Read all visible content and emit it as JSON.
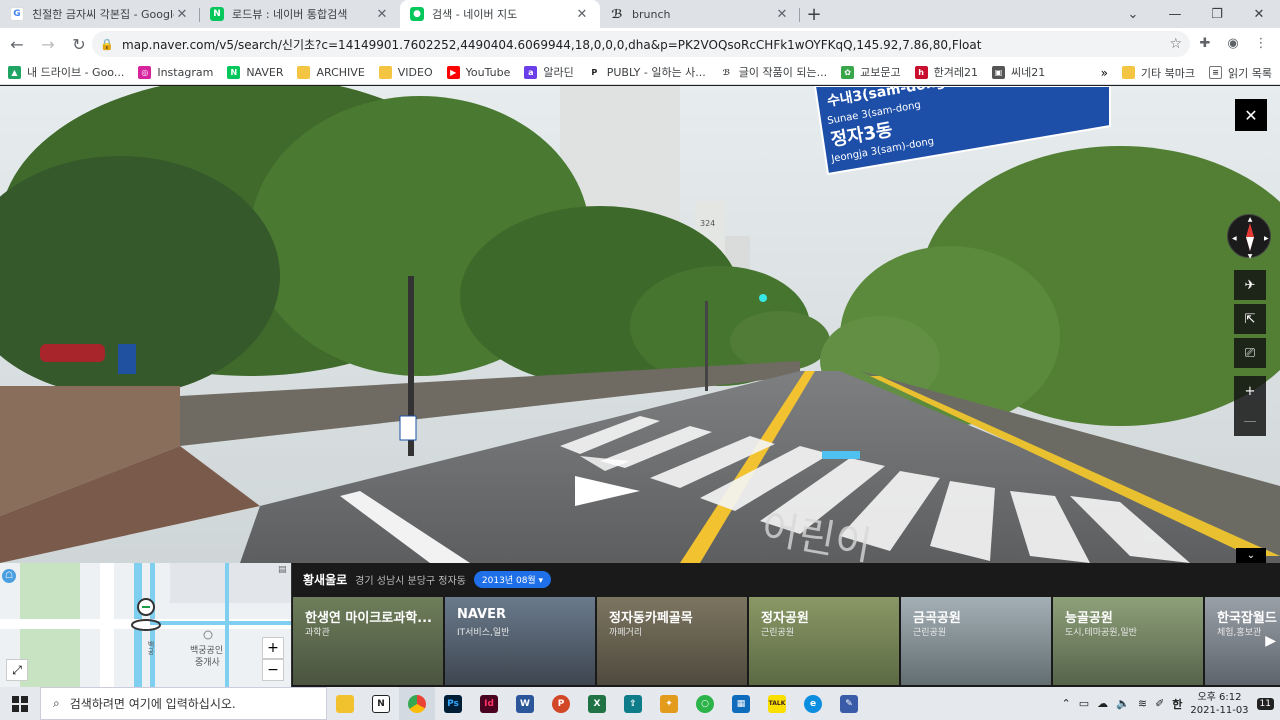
{
  "tabs": [
    {
      "title": "친절한 금자씨 각본집 - Google",
      "icon": "google-icon",
      "color": "#4285f4"
    },
    {
      "title": "로드뷰 : 네이버 통합검색",
      "icon": "naver-icon",
      "color": "#03c75a"
    },
    {
      "title": "검색 - 네이버 지도",
      "icon": "naver-map-icon",
      "color": "#03c75a"
    },
    {
      "title": "brunch",
      "icon": "brunch-icon",
      "color": "#333333"
    }
  ],
  "new_tab": "+",
  "url": "map.naver.com/v5/search/신기초?c=14149901.7602252,4490404.6069944,18,0,0,0,dha&p=PK2VOQsoRcCHFk1wOYFKqQ,145.92,7.86,80,Float",
  "bookmarks": [
    {
      "label": "내 드라이브 - Goo...",
      "icon": "drive-icon",
      "color": "#1fa463"
    },
    {
      "label": "Instagram",
      "icon": "instagram-icon",
      "color": "#d6249f"
    },
    {
      "label": "NAVER",
      "icon": "naver-icon",
      "color": "#03c75a"
    },
    {
      "label": "ARCHIVE",
      "icon": "folder-icon",
      "color": "#f4c542"
    },
    {
      "label": "VIDEO",
      "icon": "folder-icon",
      "color": "#f4c542"
    },
    {
      "label": "YouTube",
      "icon": "youtube-icon",
      "color": "#ff0000"
    },
    {
      "label": "알라딘",
      "icon": "aladin-icon",
      "color": "#6a3ee8"
    },
    {
      "label": "PUBLY - 일하는 사...",
      "icon": "publy-icon",
      "color": "#222222"
    },
    {
      "label": "글이 작품이 되는...",
      "icon": "brunch-icon",
      "color": "#333333"
    },
    {
      "label": "교보문고",
      "icon": "kyobo-icon",
      "color": "#3aa64a"
    },
    {
      "label": "한겨레21",
      "icon": "hani-icon",
      "color": "#c8102e"
    },
    {
      "label": "씨네21",
      "icon": "cine21-icon",
      "color": "#555555"
    }
  ],
  "bookmarks_more": "»",
  "bookmarks_other": "기타 북마크",
  "reading_list": "읽기 목록",
  "streetview": {
    "sign_line1": "수내3(sam-dong",
    "sign_line2": "Sunae 3(sam-dong",
    "sign_line3": "정자3동",
    "sign_line4": "Jeongja 3(sam)-dong",
    "building_no": "324",
    "road_text": "어린이"
  },
  "panel": {
    "road": "황새울로",
    "address": "경기 성남시 분당구 정자동",
    "date": "2013년 08월 ▾",
    "map_label1": "백궁공인",
    "map_label2": "중개사",
    "map_label3": "백궁",
    "zoom_in": "+",
    "zoom_out": "−"
  },
  "places": [
    {
      "name": "한생연 마이크로과학...",
      "cat": "과학관",
      "color": "#5b6b4e"
    },
    {
      "name": "NAVER",
      "cat": "IT서비스,일반",
      "color": "#4e5866"
    },
    {
      "name": "정자동카페골목",
      "cat": "까페거리",
      "color": "#5d5a4a"
    },
    {
      "name": "정자공원",
      "cat": "근린공원",
      "color": "#6e7a55"
    },
    {
      "name": "금곡공원",
      "cat": "근린공원",
      "color": "#7c8a8e"
    },
    {
      "name": "능골공원",
      "cat": "도시,테마공원,일반",
      "color": "#6f7f5e"
    },
    {
      "name": "한국잡월드",
      "cat": "체험,홍보관",
      "color": "#7a8088"
    }
  ],
  "taskbar": {
    "search_placeholder": "검색하려면 여기에 입력하십시오.",
    "apps": [
      {
        "icon": "file-explorer-icon",
        "color": "#f2c12e",
        "label": ""
      },
      {
        "icon": "notion-icon",
        "color": "#222222",
        "label": "N"
      },
      {
        "icon": "chrome-icon",
        "color": "#4285f4",
        "label": ""
      },
      {
        "icon": "photoshop-icon",
        "color": "#001e36",
        "label": "Ps"
      },
      {
        "icon": "indesign-icon",
        "color": "#49021f",
        "label": "Id"
      },
      {
        "icon": "word-icon",
        "color": "#2b579a",
        "label": "W"
      },
      {
        "icon": "powerpoint-icon",
        "color": "#d24726",
        "label": "P"
      },
      {
        "icon": "excel-icon",
        "color": "#217346",
        "label": "X"
      },
      {
        "icon": "upload-icon",
        "color": "#0f7c8a",
        "label": "⇪"
      },
      {
        "icon": "game-icon",
        "color": "#e39b1b",
        "label": "✦"
      },
      {
        "icon": "green-app-icon",
        "color": "#2cb34a",
        "label": "○"
      },
      {
        "icon": "calendar-icon",
        "color": "#0f6cbd",
        "label": "▦"
      },
      {
        "icon": "kakaotalk-icon",
        "color": "#f9e000",
        "label": "TALK"
      },
      {
        "icon": "edge-icon",
        "color": "#0c8ee0",
        "label": "e"
      },
      {
        "icon": "notepad-icon",
        "color": "#3a5ca8",
        "label": "✎"
      }
    ],
    "ime": "한",
    "time": "오후 6:12",
    "date": "2021-11-03",
    "notif": "11"
  }
}
